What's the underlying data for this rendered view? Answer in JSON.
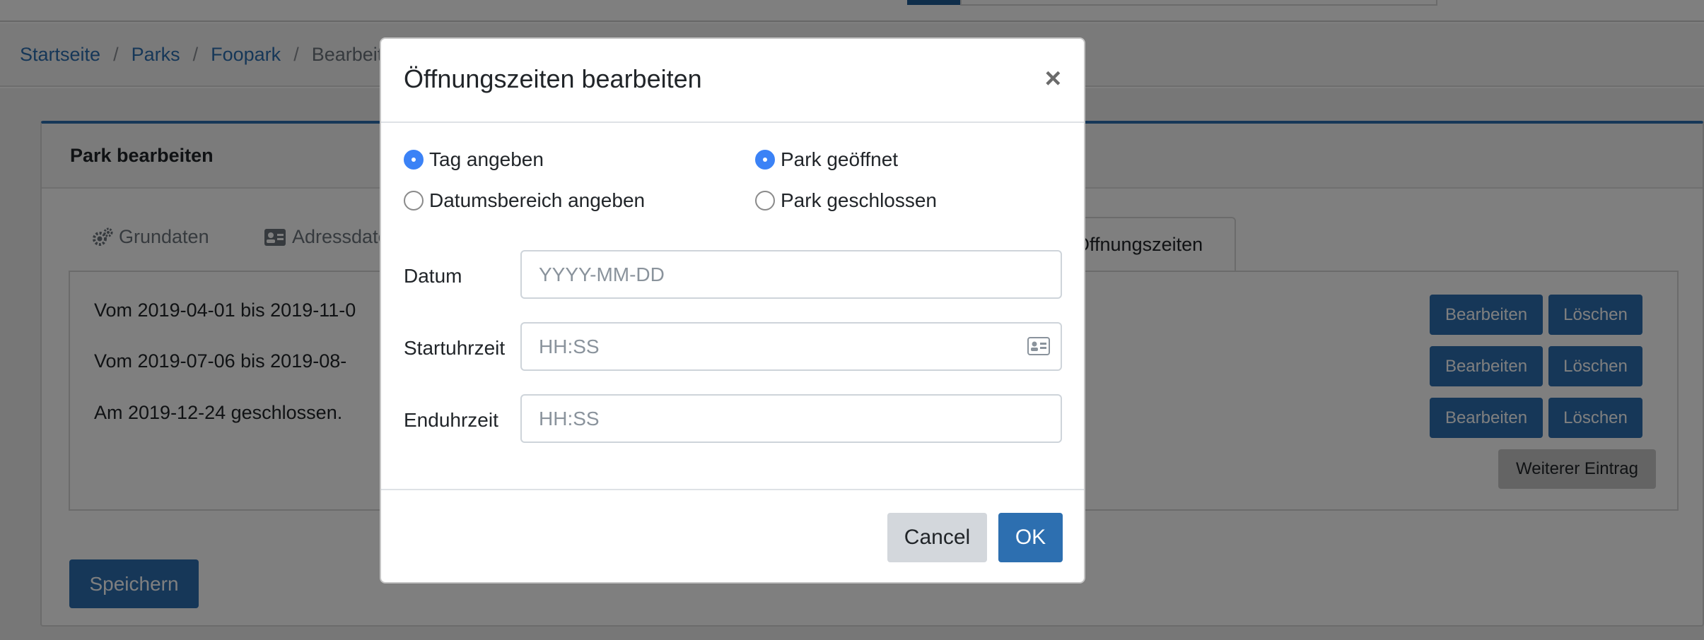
{
  "breadcrumb": {
    "items": [
      "Startseite",
      "Parks",
      "Foopark"
    ],
    "separator": "/",
    "current": "Bearbeiten"
  },
  "card": {
    "title": "Park bearbeiten",
    "tabs": {
      "grunddaten": "Grundaten",
      "adressdaten": "Adressdaten",
      "oeffnungszeiten": "Öffnungszeiten"
    },
    "entries": [
      "Vom 2019-04-01 bis 2019-11-0",
      "Vom 2019-07-06 bis 2019-08-",
      "Am 2019-12-24 geschlossen."
    ],
    "edit_label": "Bearbeiten",
    "delete_label": "Löschen",
    "add_entry_label": "Weiterer Eintrag",
    "save_label": "Speichern"
  },
  "modal": {
    "title": "Öffnungszeiten bearbeiten",
    "close_symbol": "×",
    "mode_options": [
      {
        "label": "Tag angeben",
        "checked": true
      },
      {
        "label": "Datumsbereich angeben",
        "checked": false
      }
    ],
    "status_options": [
      {
        "label": "Park geöffnet",
        "checked": true
      },
      {
        "label": "Park geschlossen",
        "checked": false
      }
    ],
    "fields": {
      "date": {
        "label": "Datum",
        "placeholder": "YYYY-MM-DD",
        "value": ""
      },
      "start": {
        "label": "Startuhrzeit",
        "placeholder": "HH:SS",
        "value": ""
      },
      "end": {
        "label": "Enduhrzeit",
        "placeholder": "HH:SS",
        "value": ""
      }
    },
    "cancel_label": "Cancel",
    "ok_label": "OK"
  },
  "icons": {
    "gears": "gears-icon",
    "address_card": "address-card-icon",
    "contact_card": "contact-card-icon"
  },
  "colors": {
    "primary": "#2d6fb0",
    "radio_checked": "#3b82f6",
    "overlay": "rgba(0,0,0,0.5)"
  }
}
